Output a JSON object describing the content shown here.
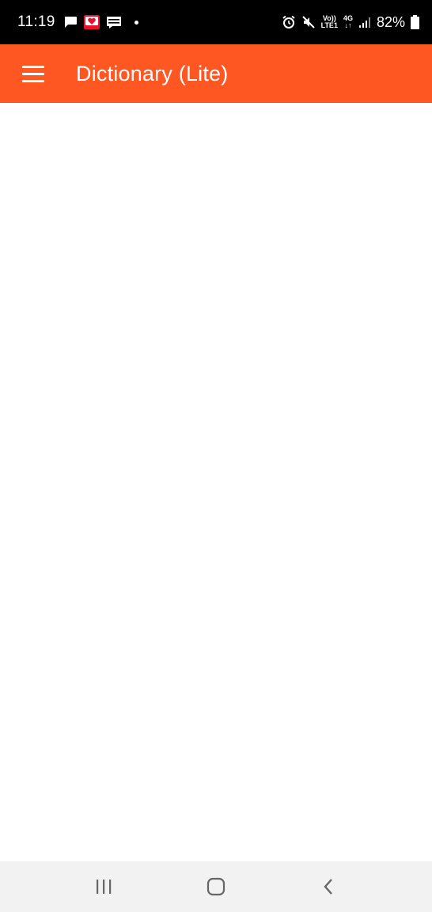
{
  "status_bar": {
    "time": "11:19",
    "battery": "82%",
    "network_top": "Vo))",
    "network_bottom": "LTE1",
    "signal_type": "4G",
    "notification_icons": [
      "message-icon",
      "heart-app-icon",
      "webtoon-icon"
    ],
    "system_icons": [
      "alarm-icon",
      "mute-icon",
      "signal-icon",
      "battery-icon"
    ]
  },
  "app_bar": {
    "title": "Dictionary (Lite)",
    "menu_icon": "hamburger-menu-icon",
    "color": "#ff5722"
  },
  "nav_bar": {
    "buttons": [
      "recent-apps-icon",
      "home-icon",
      "back-icon"
    ]
  }
}
